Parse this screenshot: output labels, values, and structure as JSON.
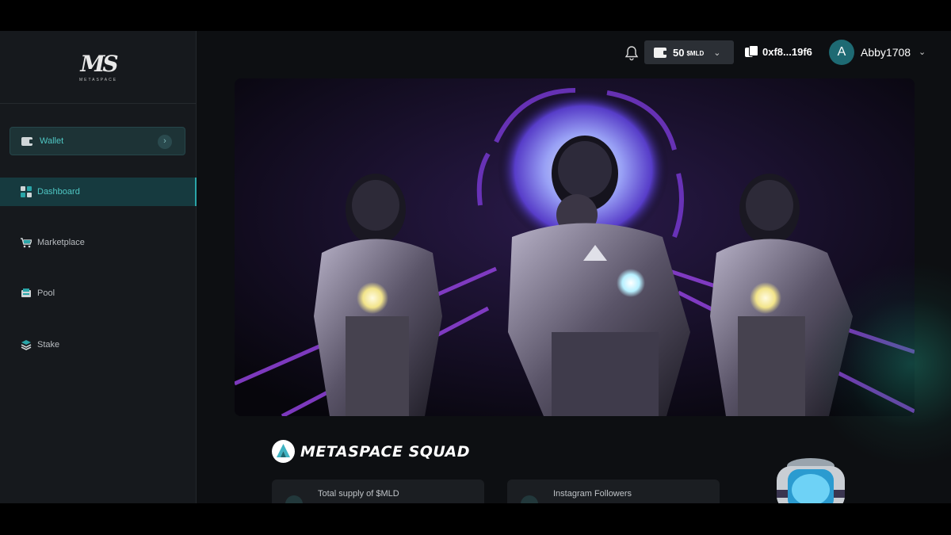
{
  "sidebar": {
    "logo_mark": "MS",
    "logo_sub": "METASPACE",
    "wallet_label": "Wallet",
    "items": [
      {
        "label": "Dashboard",
        "active": true,
        "icon": "grid-icon"
      },
      {
        "label": "Marketplace",
        "active": false,
        "icon": "cart-icon"
      },
      {
        "label": "Pool",
        "active": false,
        "icon": "pool-icon"
      },
      {
        "label": "Stake",
        "active": false,
        "icon": "stack-icon"
      }
    ]
  },
  "header": {
    "balance_amount": "50",
    "balance_token": "$MLD",
    "address": "0xf8...19f6",
    "avatar_initial": "A",
    "username": "Abby1708"
  },
  "squad": {
    "title": "METASPACE SQUAD",
    "stats": [
      {
        "label": "Total supply of $MLD"
      },
      {
        "label": "Instagram Followers"
      }
    ]
  },
  "colors": {
    "accent": "#4fc7c4",
    "sidebar_bg": "#16191d",
    "page_bg": "#0d0f12",
    "neon_purple": "#8a3fd1"
  }
}
